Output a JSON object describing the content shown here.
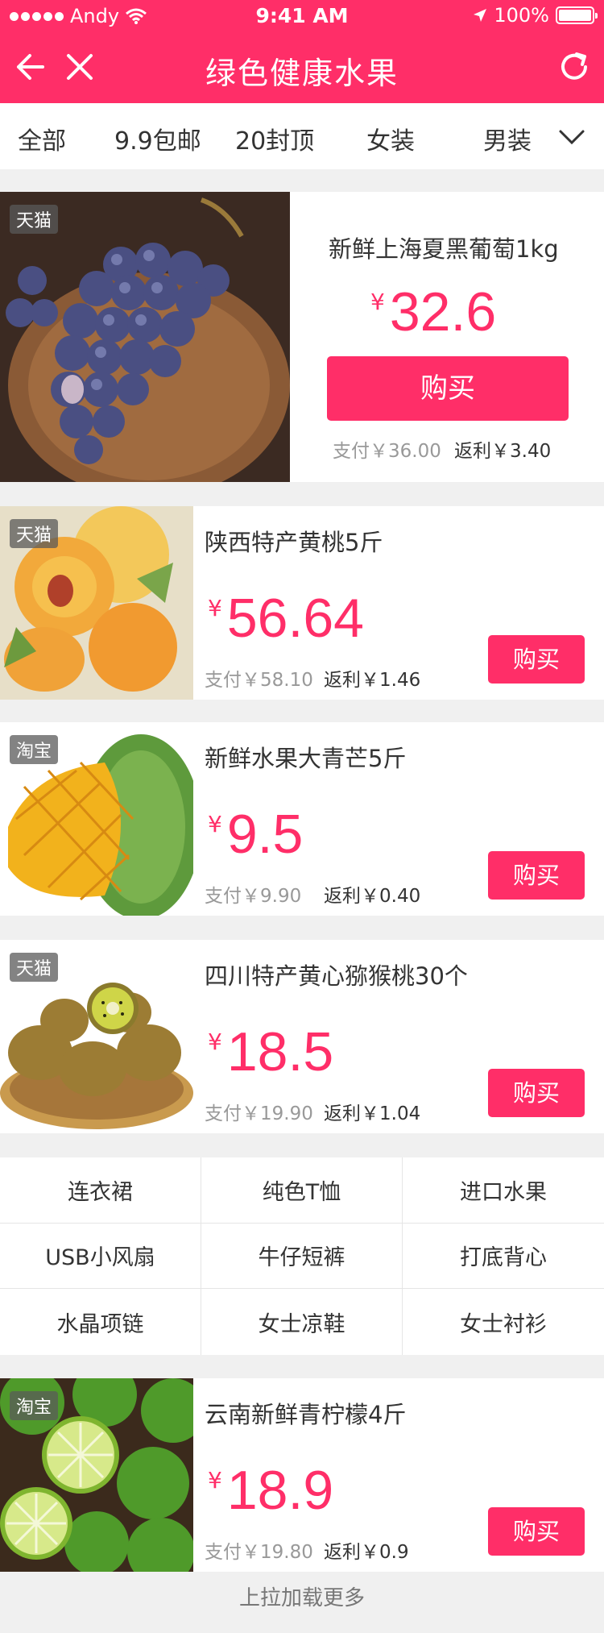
{
  "status_bar": {
    "carrier": "Andy",
    "time": "9:41 AM",
    "battery": "100%"
  },
  "nav": {
    "title": "绿色健康水果"
  },
  "categories": [
    "全部",
    "9.9包邮",
    "20封顶",
    "女装",
    "男装"
  ],
  "products": [
    {
      "tag": "天猫",
      "name": "新鲜上海夏黑葡萄1kg",
      "currency": "¥",
      "price": "32.6",
      "buy_label": "购买",
      "paid": "支付￥36.00",
      "rebate": "返利￥3.40"
    },
    {
      "tag": "天猫",
      "name": "陕西特产黄桃5斤",
      "currency": "¥",
      "price": "56.64",
      "buy_label": "购买",
      "paid": "支付￥58.10",
      "rebate": "返利￥1.46"
    },
    {
      "tag": "淘宝",
      "name": "新鲜水果大青芒5斤",
      "currency": "¥",
      "price": "9.5",
      "buy_label": "购买",
      "paid": "支付￥9.90",
      "rebate": "返利￥0.40"
    },
    {
      "tag": "天猫",
      "name": "四川特产黄心猕猴桃30个",
      "currency": "¥",
      "price": "18.5",
      "buy_label": "购买",
      "paid": "支付￥19.90",
      "rebate": "返利￥1.04"
    },
    {
      "tag": "淘宝",
      "name": "云南新鲜青柠檬4斤",
      "currency": "¥",
      "price": "18.9",
      "buy_label": "购买",
      "paid": "支付￥19.80",
      "rebate": "返利￥0.9"
    }
  ],
  "tag_grid": [
    "连衣裙",
    "纯色T恤",
    "进口水果",
    "USB小风扇",
    "牛仔短裤",
    "打底背心",
    "水晶项链",
    "女士凉鞋",
    "女士衬衫"
  ],
  "footer": {
    "load_more": "上拉加载更多"
  },
  "colors": {
    "accent": "#ff2e68",
    "background": "#f0f0f0"
  },
  "icons": [
    "back-icon",
    "close-icon",
    "refresh-icon",
    "chevron-down-icon",
    "signal-icon",
    "wifi-icon",
    "location-arrow-icon",
    "battery-icon"
  ]
}
